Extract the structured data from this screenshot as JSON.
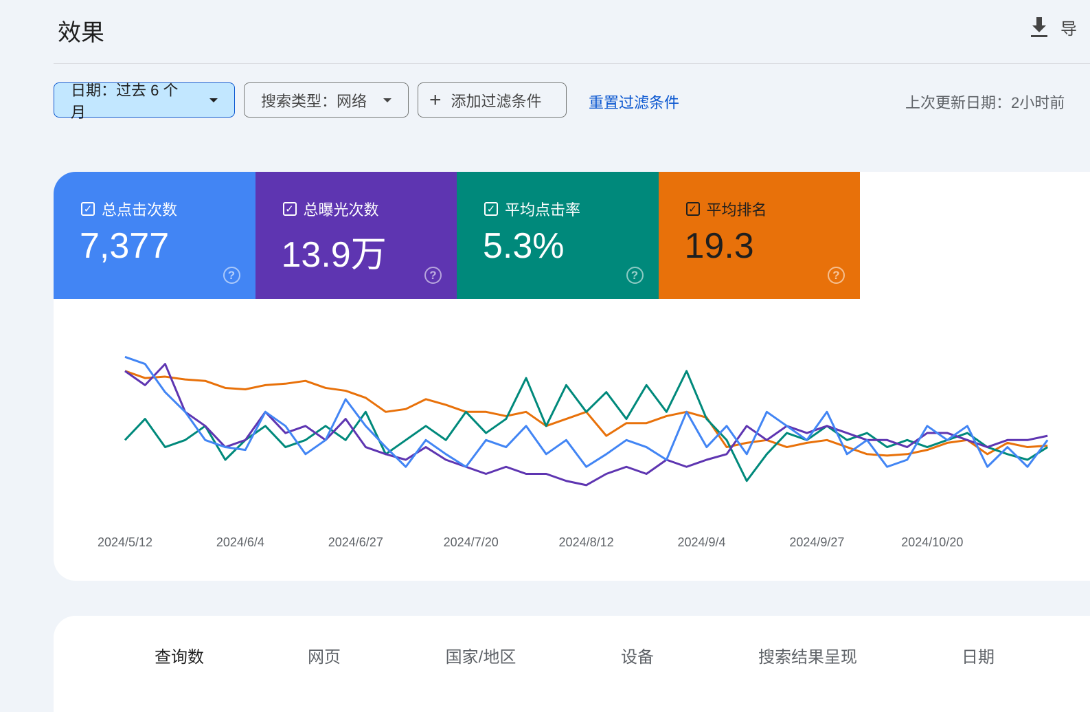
{
  "header": {
    "title": "效果",
    "export_label": "导",
    "export_icon": "download-icon"
  },
  "filters": {
    "date": "日期：过去 6 个月",
    "search_type": "搜索类型：网络",
    "add_filter": "添加过滤条件",
    "reset": "重置过滤条件",
    "last_updated": "上次更新日期：2小时前"
  },
  "metrics": [
    {
      "label": "总点击次数",
      "value": "7,377",
      "color": "#4285f4",
      "checked": true
    },
    {
      "label": "总曝光次数",
      "value": "13.9万",
      "color": "#5e35b1",
      "checked": true
    },
    {
      "label": "平均点击率",
      "value": "5.3%",
      "color": "#00897b",
      "checked": true
    },
    {
      "label": "平均排名",
      "value": "19.3",
      "color": "#e8710a",
      "checked": true
    }
  ],
  "chart_data": {
    "type": "line",
    "title": "",
    "xlabel": "",
    "ylabel": "",
    "y_axis": "hidden, each series independently scaled (relative 0-100)",
    "grid": false,
    "x_ticks": [
      "2024/5/12",
      "2024/6/4",
      "2024/6/27",
      "2024/7/20",
      "2024/8/12",
      "2024/9/4",
      "2024/9/27",
      "2024/10/20"
    ],
    "x": [
      "2024-05-12",
      "2024-05-16",
      "2024-05-20",
      "2024-05-24",
      "2024-05-28",
      "2024-06-01",
      "2024-06-05",
      "2024-06-09",
      "2024-06-13",
      "2024-06-17",
      "2024-06-21",
      "2024-06-25",
      "2024-06-29",
      "2024-07-03",
      "2024-07-07",
      "2024-07-11",
      "2024-07-15",
      "2024-07-19",
      "2024-07-23",
      "2024-07-27",
      "2024-07-31",
      "2024-08-04",
      "2024-08-08",
      "2024-08-12",
      "2024-08-16",
      "2024-08-20",
      "2024-08-24",
      "2024-08-28",
      "2024-09-01",
      "2024-09-05",
      "2024-09-09",
      "2024-09-13",
      "2024-09-17",
      "2024-09-21",
      "2024-09-25",
      "2024-09-29",
      "2024-10-03",
      "2024-10-07",
      "2024-10-11",
      "2024-10-15",
      "2024-10-19",
      "2024-10-23",
      "2024-10-27",
      "2024-10-31",
      "2024-11-04",
      "2024-11-08",
      "2024-11-12"
    ],
    "series": [
      {
        "color": "#e8710a",
        "values": [
          83,
          78,
          79,
          77,
          76,
          71,
          70,
          73,
          74,
          76,
          71,
          69,
          64,
          54,
          56,
          63,
          59,
          54,
          54,
          51,
          54,
          44,
          49,
          54,
          37,
          46,
          46,
          51,
          54,
          50,
          29,
          32,
          34,
          29,
          32,
          34,
          29,
          24,
          23,
          24,
          27,
          32,
          34,
          24,
          32,
          29,
          30
        ]
      },
      {
        "color": "#00897b",
        "values": [
          34,
          49,
          29,
          34,
          44,
          20,
          34,
          44,
          29,
          34,
          44,
          34,
          54,
          24,
          34,
          44,
          34,
          54,
          39,
          49,
          78,
          44,
          73,
          54,
          68,
          49,
          73,
          54,
          83,
          49,
          34,
          5,
          24,
          39,
          34,
          44,
          34,
          39,
          29,
          34,
          29,
          34,
          39,
          29,
          24,
          20,
          29
        ]
      },
      {
        "color": "#5e35b1",
        "values": [
          83,
          73,
          88,
          54,
          44,
          29,
          34,
          54,
          39,
          44,
          34,
          49,
          29,
          24,
          20,
          29,
          20,
          15,
          10,
          15,
          10,
          10,
          5,
          2,
          10,
          15,
          10,
          20,
          15,
          20,
          24,
          44,
          34,
          44,
          39,
          44,
          39,
          34,
          34,
          29,
          39,
          39,
          34,
          29,
          34,
          34,
          37
        ]
      },
      {
        "color": "#4285f4",
        "values": [
          93,
          88,
          68,
          54,
          34,
          29,
          27,
          54,
          44,
          24,
          34,
          63,
          44,
          29,
          15,
          34,
          24,
          15,
          34,
          29,
          44,
          24,
          34,
          15,
          24,
          34,
          29,
          20,
          54,
          29,
          44,
          24,
          54,
          44,
          34,
          54,
          24,
          34,
          15,
          20,
          44,
          34,
          44,
          15,
          29,
          15,
          34
        ]
      }
    ]
  },
  "tabs": [
    {
      "label": "查询数",
      "active": true
    },
    {
      "label": "网页"
    },
    {
      "label": "国家/地区"
    },
    {
      "label": "设备"
    },
    {
      "label": "搜索结果呈现"
    },
    {
      "label": "日期"
    }
  ]
}
